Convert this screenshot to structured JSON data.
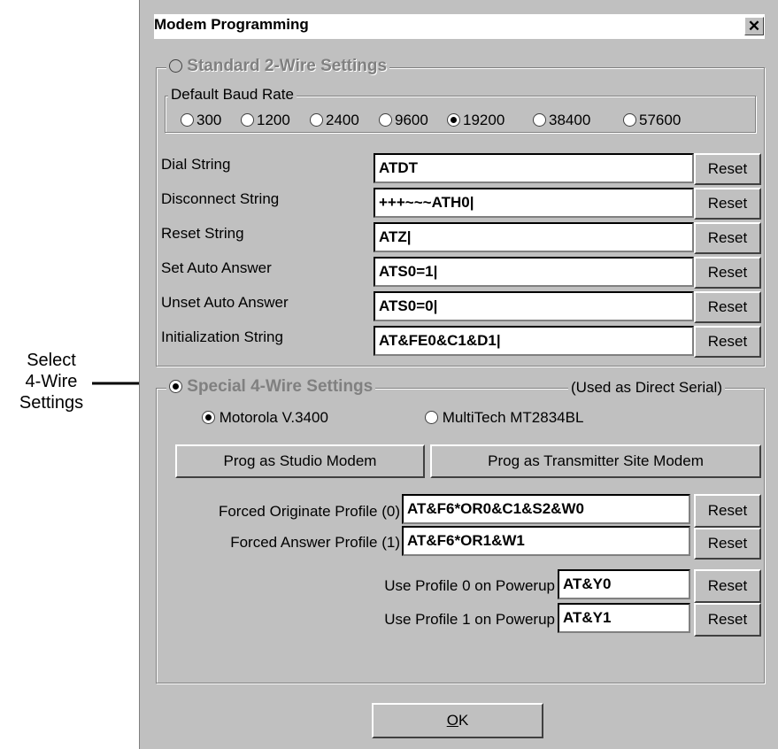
{
  "callout": {
    "line1": "Select",
    "line2": "4-Wire",
    "line3": "Settings"
  },
  "window": {
    "title": "Modem Programming",
    "close_glyph": "✕"
  },
  "standard": {
    "title": "Standard 2-Wire Settings",
    "selected": false,
    "baud_group": "Default Baud Rate",
    "baud_options": [
      "300",
      "1200",
      "2400",
      "9600",
      "19200",
      "38400",
      "57600"
    ],
    "baud_selected": "19200",
    "fields": [
      {
        "label": "Dial String",
        "value": "ATDT",
        "reset": "Reset"
      },
      {
        "label": "Disconnect String",
        "value": "+++~~~ATH0|",
        "reset": "Reset"
      },
      {
        "label": "Reset String",
        "value": "ATZ|",
        "reset": "Reset"
      },
      {
        "label": "Set Auto Answer",
        "value": "ATS0=1|",
        "reset": "Reset"
      },
      {
        "label": "Unset Auto Answer",
        "value": "ATS0=0|",
        "reset": "Reset"
      },
      {
        "label": "Initialization String",
        "value": "AT&FE0&C1&D1|",
        "reset": "Reset"
      }
    ]
  },
  "special": {
    "title": "Special 4-Wire Settings",
    "note": "(Used as Direct Serial)",
    "selected": true,
    "modem_options": [
      "Motorola V.3400",
      "MultiTech MT2834BL"
    ],
    "modem_selected": "Motorola V.3400",
    "prog_studio": "Prog as Studio Modem",
    "prog_transmitter": "Prog as Transmitter Site Modem",
    "profiles": [
      {
        "label": "Forced Originate Profile (0)",
        "value": "AT&F6*OR0&C1&S2&W0",
        "reset": "Reset"
      },
      {
        "label": "Forced Answer Profile (1)",
        "value": "AT&F6*OR1&W1",
        "reset": "Reset"
      },
      {
        "label": "Use Profile 0 on Powerup",
        "value": "AT&Y0",
        "reset": "Reset"
      },
      {
        "label": "Use Profile 1 on Powerup",
        "value": "AT&Y1",
        "reset": "Reset"
      }
    ]
  },
  "ok_label": "OK"
}
